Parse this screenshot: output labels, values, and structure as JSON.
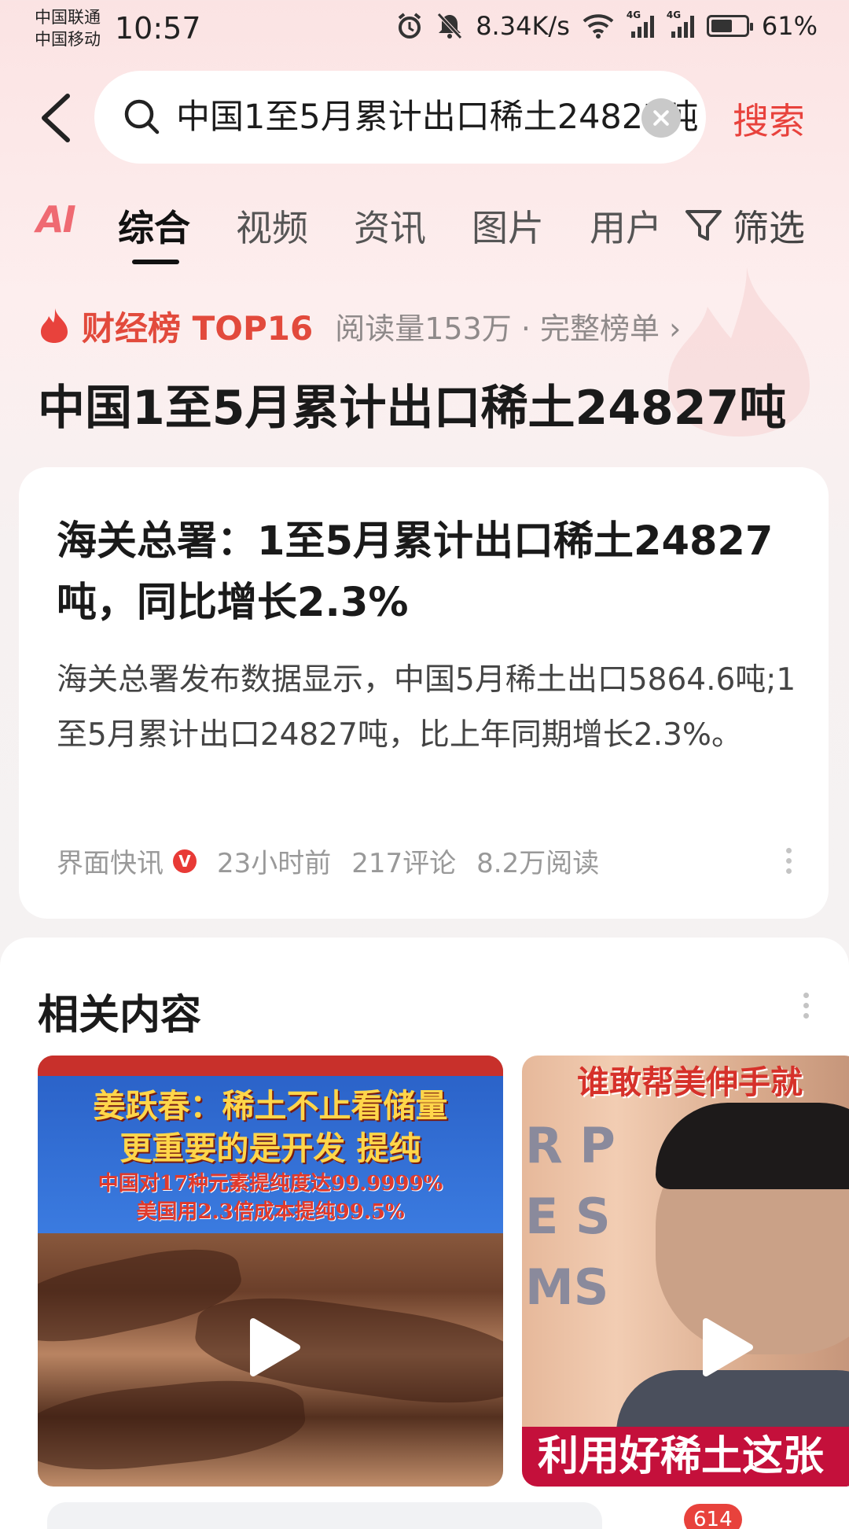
{
  "status_bar": {
    "carrier_1": "中国联通",
    "carrier_2": "中国移动",
    "time": "10:57",
    "net_speed": "8.34K/s",
    "network_1": "4G",
    "network_2": "4G",
    "battery": "61%",
    "battery_level": 0.61
  },
  "search": {
    "query": "中国1至5月累计出口稀土24827吨",
    "submit_label": "搜索"
  },
  "tabs": {
    "ai_label": "AI",
    "items": [
      "综合",
      "视频",
      "资讯",
      "图片",
      "用户"
    ],
    "active": "综合",
    "filter_label": "筛选"
  },
  "hot_topic": {
    "rank_label": "财经榜 TOP16",
    "meta": "阅读量153万 · 完整榜单 ›",
    "title": "中国1至5月累计出口稀土24827吨"
  },
  "article": {
    "title": "海关总署：1至5月累计出口稀土24827吨，同比增长2.3%",
    "summary": "海关总署发布数据显示，中国5月稀土出口5864.6吨;1至5月累计出口24827吨，比上年同期增长2.3%。",
    "source": "界面快讯",
    "verified_badge": "V",
    "time": "23小时前",
    "comments": "217评论",
    "reads": "8.2万阅读"
  },
  "related": {
    "title": "相关内容",
    "videos": [
      {
        "line1": "姜跃春：稀土不止看储量",
        "line2": "更重要的是开发 提纯",
        "line3": "中国对17种元素提纯度达99.9999%",
        "line4": "美国用2.3倍成本提纯99.5%"
      },
      {
        "top_text": "谁敢帮美伸手就",
        "letters": "R P\nE S\nMS",
        "bottom_text": "利用好稀土这张"
      }
    ]
  },
  "bottom": {
    "badge": "614"
  },
  "colors": {
    "accent": "#e8423c",
    "background_top": "#fbe3e3",
    "card": "#ffffff"
  }
}
